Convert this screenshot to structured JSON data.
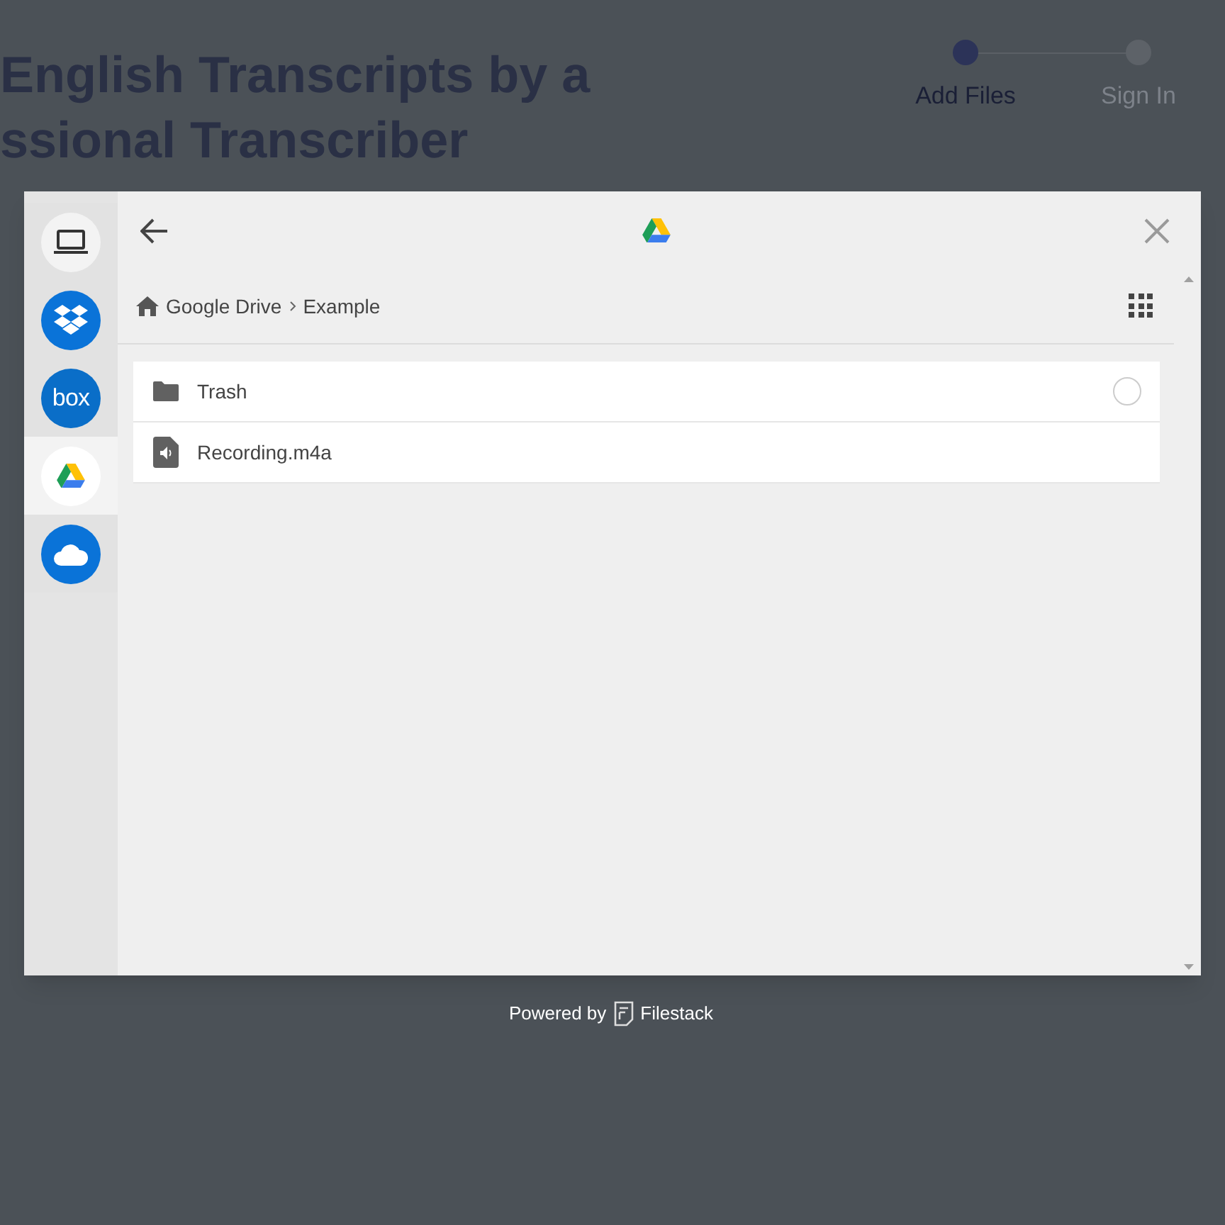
{
  "page": {
    "heading_lines": [
      "English Transcripts by a",
      "ssional Transcriber"
    ],
    "steps": [
      {
        "label": "Add Files",
        "selected": true
      },
      {
        "label": "Sign In",
        "selected": false
      }
    ]
  },
  "picker": {
    "sources": [
      {
        "kind": "computer",
        "selected": false
      },
      {
        "kind": "dropbox",
        "selected": false
      },
      {
        "kind": "box",
        "label": "box",
        "selected": false
      },
      {
        "kind": "drive",
        "selected": true
      },
      {
        "kind": "onedrive",
        "selected": false
      }
    ],
    "breadcrumb": [
      "Google Drive",
      "Example"
    ],
    "files": [
      {
        "kind": "folder",
        "name": "Trash",
        "hovered": true
      },
      {
        "kind": "audio",
        "name": "Recording.m4a",
        "hovered": false
      }
    ],
    "footer": {
      "prefix": "Powered by",
      "brand": "Filestack"
    }
  }
}
